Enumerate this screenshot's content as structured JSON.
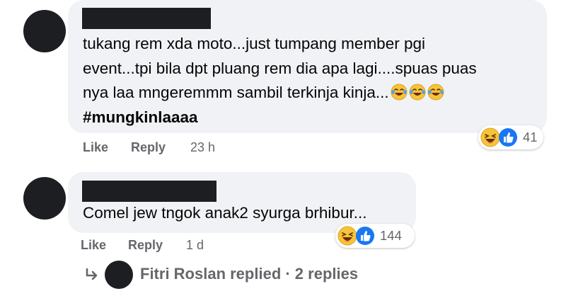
{
  "comments": [
    {
      "text_lines": [
        "tukang rem xda moto...just tumpang member pgi",
        "event...tpi bila dpt pluang rem dia apa lagi....spuas puas",
        "nya laa mngeremmm sambil terkinja kinja..."
      ],
      "inline_emojis": [
        "laughing-tears",
        "laughing-tears",
        "laughing-tears"
      ],
      "hashtag": "#mungkinlaaaa",
      "like_label": "Like",
      "reply_label": "Reply",
      "timestamp": "23 h",
      "reaction_count": "41",
      "reaction_icons": [
        "haha",
        "like"
      ]
    },
    {
      "text_lines": [
        "Comel jew tngok anak2 syurga brhibur..."
      ],
      "like_label": "Like",
      "reply_label": "Reply",
      "timestamp": "1 d",
      "reaction_count": "144",
      "reaction_icons": [
        "haha",
        "like"
      ]
    }
  ],
  "replies_summary": {
    "text": "Fitri Roslan replied · 2 replies",
    "icon": "reply-arrow-icon"
  },
  "colors": {
    "bubble": "#f0f2f5",
    "meta_text": "#65676b",
    "like_blue": "#1877f2",
    "haha_yellow": "#f7b125"
  }
}
